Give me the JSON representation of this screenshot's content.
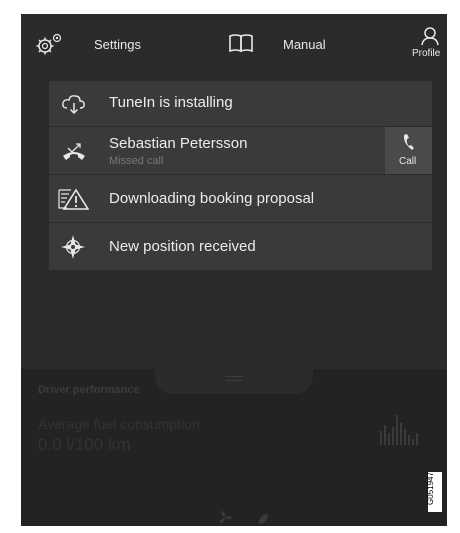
{
  "topbar": {
    "settings_label": "Settings",
    "manual_label": "Manual",
    "profile_label": "Profile"
  },
  "notifications": [
    {
      "icon": "cloud-download-icon",
      "title": "TuneIn is installing"
    },
    {
      "icon": "missed-call-icon",
      "title": "Sebastian Petersson",
      "subtitle": "Missed call",
      "action": "Call"
    },
    {
      "icon": "warning-doc-icon",
      "title": "Downloading booking proposal"
    },
    {
      "icon": "position-icon",
      "title": "New position received"
    }
  ],
  "widget": {
    "section_title": "Driver performance",
    "metric_label": "Average fuel consumption",
    "metric_value": "0.0 l/100 km"
  },
  "figure_code": "G051947"
}
